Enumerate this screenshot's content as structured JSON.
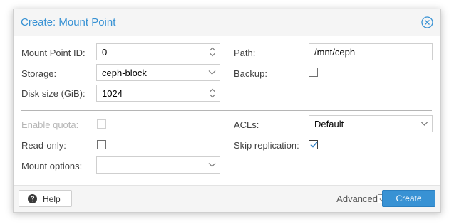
{
  "dialog": {
    "title": "Create: Mount Point",
    "close_icon": "close-circle-icon"
  },
  "left_top": {
    "mount_point_id": {
      "label": "Mount Point ID:",
      "value": "0"
    },
    "storage": {
      "label": "Storage:",
      "value": "ceph-block"
    },
    "disk_size": {
      "label": "Disk size (GiB):",
      "value": "1024"
    }
  },
  "right_top": {
    "path": {
      "label": "Path:",
      "value": "/mnt/ceph"
    },
    "backup": {
      "label": "Backup:",
      "checked": false
    }
  },
  "left_bottom": {
    "enable_quota": {
      "label": "Enable quota:",
      "checked": false,
      "disabled": true
    },
    "read_only": {
      "label": "Read-only:",
      "checked": false
    },
    "mount_options": {
      "label": "Mount options:",
      "value": ""
    }
  },
  "right_bottom": {
    "acls": {
      "label": "ACLs:",
      "value": "Default"
    },
    "skip_replication": {
      "label": "Skip replication:",
      "checked": true
    }
  },
  "footer": {
    "help_label": "Help",
    "help_icon": "question-circle-icon",
    "advanced_label": "Advanced",
    "advanced_checked": true,
    "create_label": "Create"
  },
  "colors": {
    "accent": "#3892d4",
    "disabled_text": "#b7b7b7"
  }
}
